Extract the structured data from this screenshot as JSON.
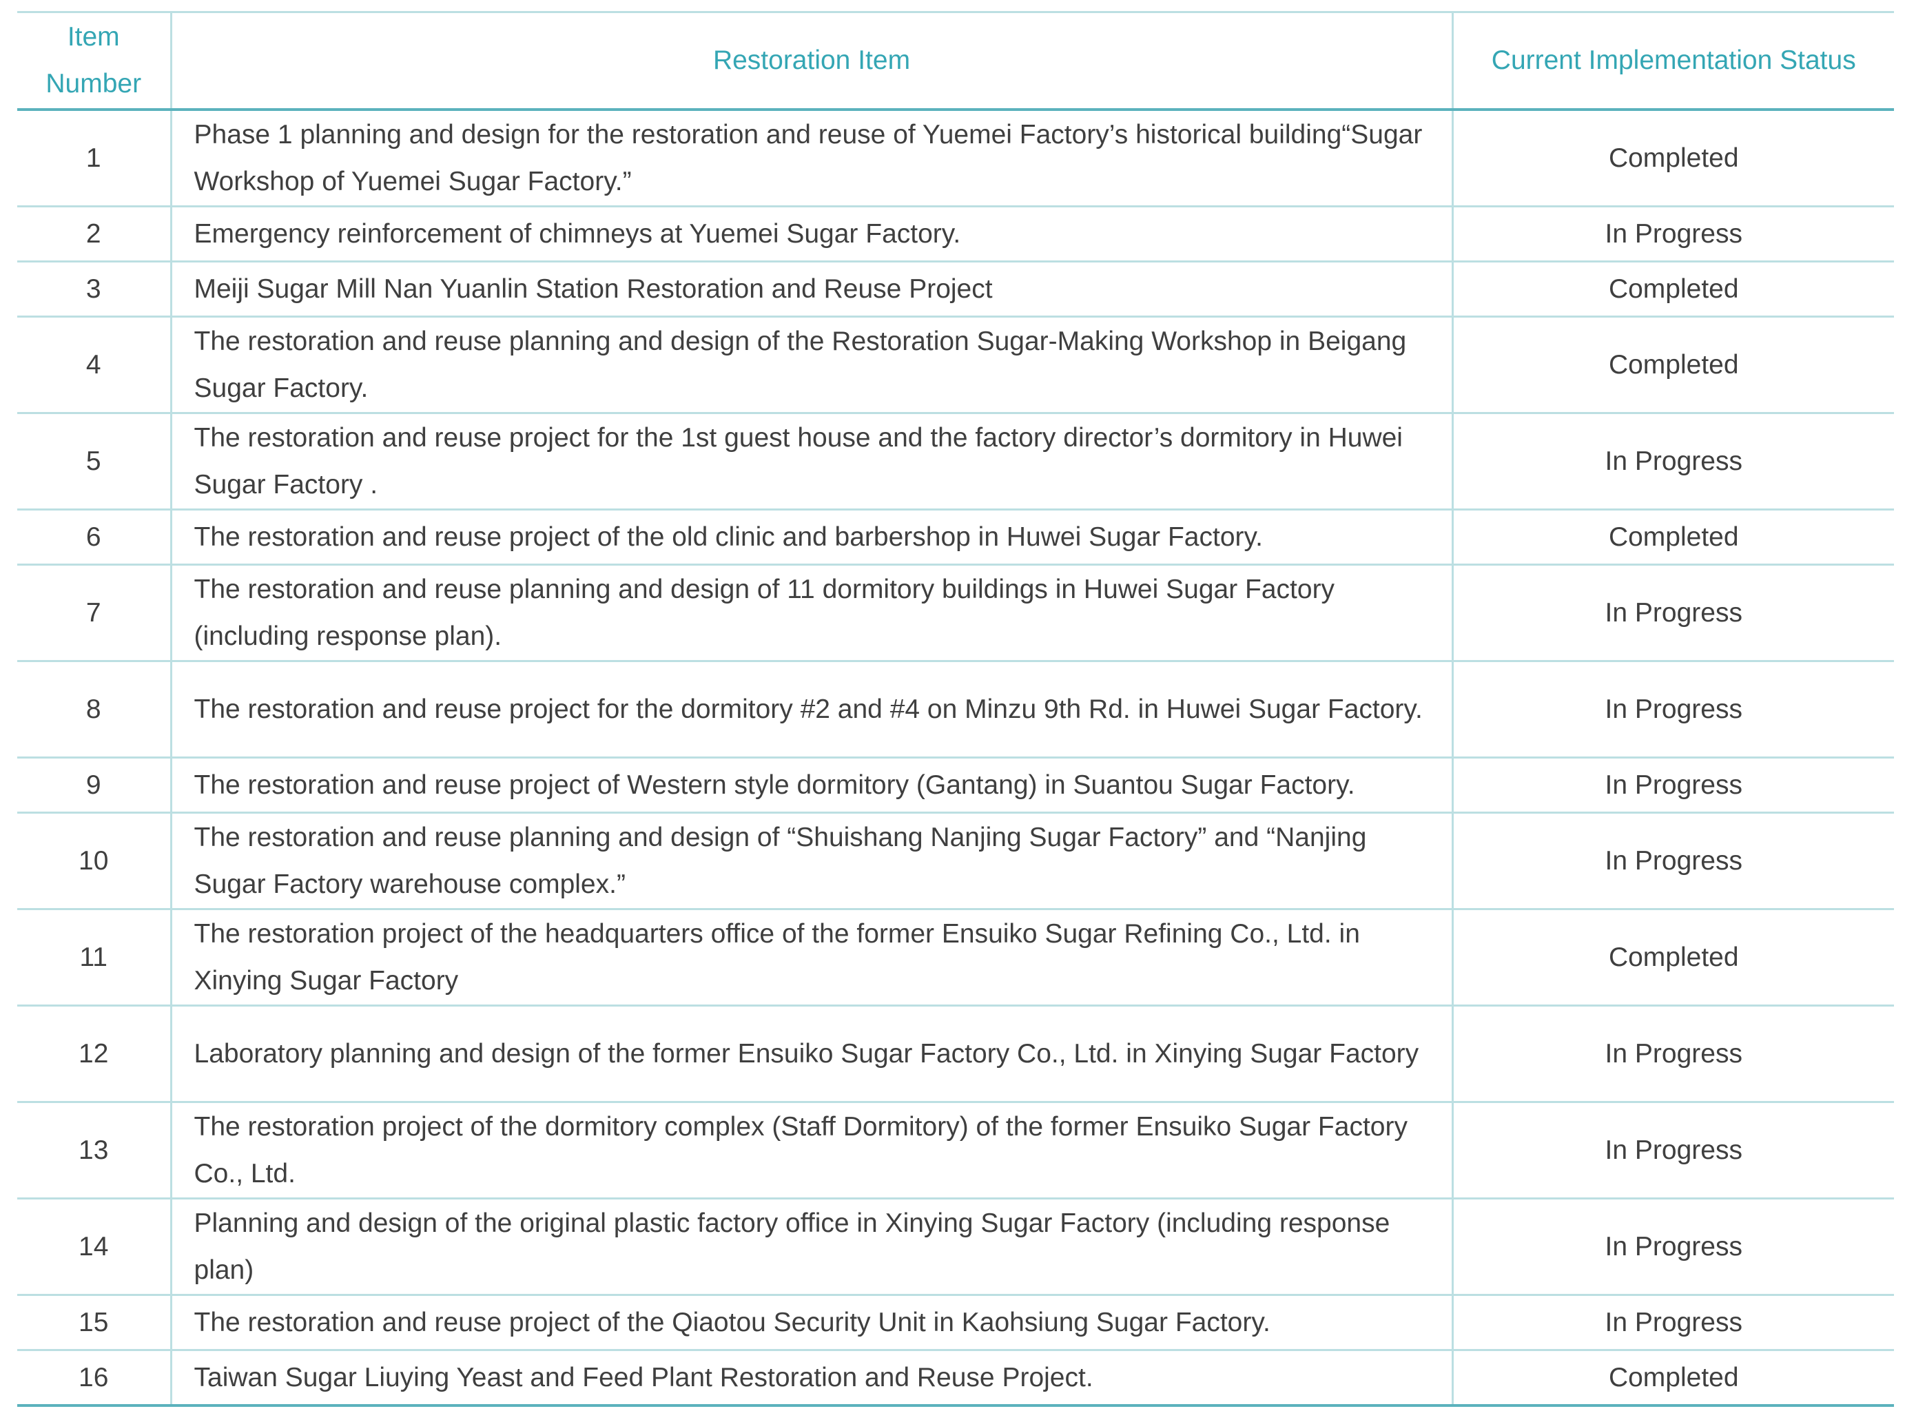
{
  "table": {
    "headers": {
      "number": "Item\nNumber",
      "item": "Restoration Item",
      "status": "Current Implementation Status"
    },
    "rows": [
      {
        "number": "1",
        "item": "Phase 1 planning and design for the restoration and reuse of Yuemei Factory’s historical building“Sugar Workshop of Yuemei Sugar Factory.”",
        "status": "Completed"
      },
      {
        "number": "2",
        "item": "Emergency reinforcement of chimneys at Yuemei Sugar Factory.",
        "status": "In Progress"
      },
      {
        "number": "3",
        "item": "Meiji Sugar Mill Nan Yuanlin Station Restoration and Reuse Project",
        "status": "Completed"
      },
      {
        "number": "4",
        "item": "The restoration and reuse planning and design of the Restoration Sugar-Making Workshop in Beigang Sugar Factory.",
        "status": "Completed"
      },
      {
        "number": "5",
        "item": "The restoration and reuse project for the 1st guest house and the factory director’s dormitory in Huwei Sugar Factory .",
        "status": "In Progress"
      },
      {
        "number": "6",
        "item": "The restoration and reuse project of the old clinic and barbershop in Huwei Sugar Factory.",
        "status": "Completed"
      },
      {
        "number": "7",
        "item": "The restoration and reuse planning and design of 11 dormitory buildings in Huwei Sugar Factory (including response plan).",
        "status": "In Progress"
      },
      {
        "number": "8",
        "item": "The restoration and reuse project for the dormitory #2 and #4 on Minzu 9th Rd. in Huwei Sugar Factory.",
        "status": "In Progress"
      },
      {
        "number": "9",
        "item": "The restoration and reuse project of Western style dormitory (Gantang) in Suantou Sugar Factory.",
        "status": "In Progress"
      },
      {
        "number": "10",
        "item": "The restoration and reuse planning and design of “Shuishang Nanjing Sugar Factory” and “Nanjing Sugar Factory warehouse complex.”",
        "status": "In Progress"
      },
      {
        "number": "11",
        "item": "The restoration project of the headquarters office of the former Ensuiko Sugar Refining Co., Ltd. in Xinying Sugar Factory",
        "status": "Completed"
      },
      {
        "number": "12",
        "item": "Laboratory planning and design of the former Ensuiko Sugar Factory Co., Ltd. in Xinying Sugar Factory",
        "status": "In Progress"
      },
      {
        "number": "13",
        "item": "The restoration project of the dormitory complex (Staff Dormitory) of the former Ensuiko Sugar Factory Co., Ltd.",
        "status": "In Progress"
      },
      {
        "number": "14",
        "item": "Planning and design of the original plastic factory office in Xinying Sugar Factory (including response plan)",
        "status": "In Progress"
      },
      {
        "number": "15",
        "item": "The restoration and reuse project of the Qiaotou Security Unit in Kaohsiung Sugar Factory.",
        "status": "In Progress"
      },
      {
        "number": "16",
        "item": "Taiwan Sugar Liuying Yeast and Feed Plant Restoration and Reuse Project.",
        "status": "Completed"
      }
    ]
  }
}
